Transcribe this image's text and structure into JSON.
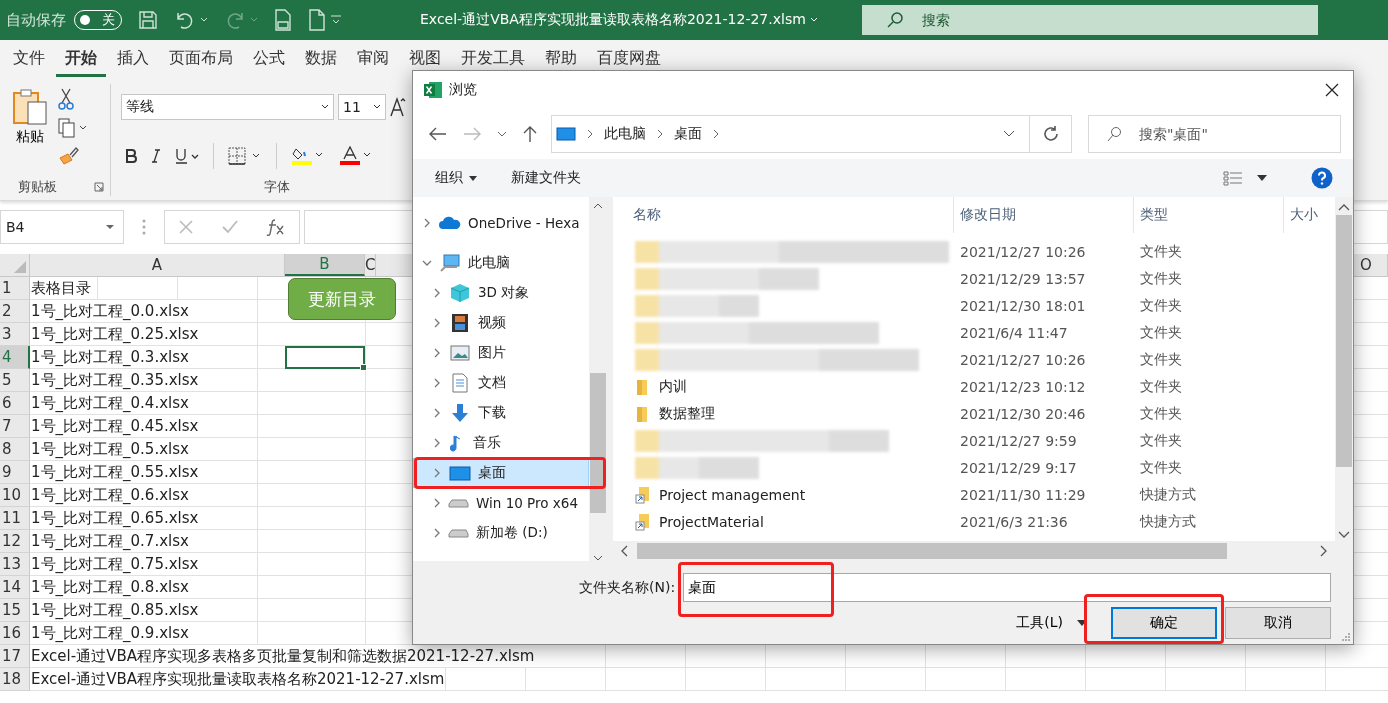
{
  "title_bar": {
    "autosave_label": "自动保存",
    "autosave": {
      "on": false,
      "label": "关"
    },
    "title": "Excel-通过VBA程序实现批量读取表格名称2021-12-27.xlsm",
    "search": {
      "placeholder": "搜索"
    }
  },
  "ribbon_tabs": [
    {
      "label": "文件",
      "selected": false
    },
    {
      "label": "开始",
      "selected": true
    },
    {
      "label": "插入",
      "selected": false
    },
    {
      "label": "页面布局",
      "selected": false
    },
    {
      "label": "公式",
      "selected": false
    },
    {
      "label": "数据",
      "selected": false
    },
    {
      "label": "审阅",
      "selected": false
    },
    {
      "label": "视图",
      "selected": false
    },
    {
      "label": "开发工具",
      "selected": false
    },
    {
      "label": "帮助",
      "selected": false
    },
    {
      "label": "百度网盘",
      "selected": false
    }
  ],
  "ribbon": {
    "paste_label": "粘贴",
    "clipboard_group": "剪贴板",
    "font_name": "等线",
    "font_size": "11",
    "font_group": "字体"
  },
  "formula_bar": {
    "name_box": "B4"
  },
  "sheet": {
    "button": "更新目录",
    "columns": [
      {
        "label": "A",
        "selected": false
      },
      {
        "label": "B",
        "selected": true
      },
      {
        "label": "C",
        "selected": false
      },
      {
        "label": "O",
        "selected": false
      }
    ],
    "rows": [
      {
        "number": "1",
        "a": "表格目录",
        "selected": false
      },
      {
        "number": "2",
        "a": "1号_比对工程_0.0.xlsx",
        "selected": false
      },
      {
        "number": "3",
        "a": "1号_比对工程_0.25.xlsx",
        "selected": false
      },
      {
        "number": "4",
        "a": "1号_比对工程_0.3.xlsx",
        "selected": true
      },
      {
        "number": "5",
        "a": "1号_比对工程_0.35.xlsx",
        "selected": false
      },
      {
        "number": "6",
        "a": "1号_比对工程_0.4.xlsx",
        "selected": false
      },
      {
        "number": "7",
        "a": "1号_比对工程_0.45.xlsx",
        "selected": false
      },
      {
        "number": "8",
        "a": "1号_比对工程_0.5.xlsx",
        "selected": false
      },
      {
        "number": "9",
        "a": "1号_比对工程_0.55.xlsx",
        "selected": false
      },
      {
        "number": "10",
        "a": "1号_比对工程_0.6.xlsx",
        "selected": false
      },
      {
        "number": "11",
        "a": "1号_比对工程_0.65.xlsx",
        "selected": false
      },
      {
        "number": "12",
        "a": "1号_比对工程_0.7.xlsx",
        "selected": false
      },
      {
        "number": "13",
        "a": "1号_比对工程_0.75.xlsx",
        "selected": false
      },
      {
        "number": "14",
        "a": "1号_比对工程_0.8.xlsx",
        "selected": false
      },
      {
        "number": "15",
        "a": "1号_比对工程_0.85.xlsx",
        "selected": false
      },
      {
        "number": "16",
        "a": "1号_比对工程_0.9.xlsx",
        "selected": false
      },
      {
        "number": "17",
        "a": "Excel-通过VBA程序实现多表格多页批量复制和筛选数据2021-12-27.xlsm",
        "selected": false
      },
      {
        "number": "18",
        "a": "Excel-通过VBA程序实现批量读取表格名称2021-12-27.xlsm",
        "selected": false
      }
    ]
  },
  "dialog": {
    "title": "浏览",
    "breadcrumb": [
      "此电脑",
      "桌面"
    ],
    "search_placeholder": "搜索\"桌面\"",
    "organize": "组织",
    "new_folder": "新建文件夹",
    "tree": [
      {
        "label": "OneDrive - Hexa",
        "kind": "cloud",
        "expanded": false,
        "selected": false
      },
      {
        "label": "此电脑",
        "kind": "pc",
        "expanded": true,
        "selected": false,
        "children": [
          {
            "label": "3D 对象",
            "kind": "cube",
            "expanded": false,
            "selected": false
          },
          {
            "label": "视频",
            "kind": "video",
            "expanded": false,
            "selected": false
          },
          {
            "label": "图片",
            "kind": "image",
            "expanded": false,
            "selected": false
          },
          {
            "label": "文档",
            "kind": "doc",
            "expanded": false,
            "selected": false
          },
          {
            "label": "下载",
            "kind": "download",
            "expanded": false,
            "selected": false
          },
          {
            "label": "音乐",
            "kind": "music",
            "expanded": false,
            "selected": false
          },
          {
            "label": "桌面",
            "kind": "desktop",
            "expanded": false,
            "selected": true
          },
          {
            "label": "Win 10 Pro x64",
            "kind": "drive",
            "expanded": false,
            "selected": false
          },
          {
            "label": "新加卷 (D:)",
            "kind": "drive",
            "expanded": false,
            "selected": false
          }
        ]
      }
    ],
    "columns": [
      "名称",
      "修改日期",
      "类型",
      "大小"
    ],
    "files": [
      {
        "kind": "blurred",
        "date": "2021/12/27 10:26",
        "type": "文件夹"
      },
      {
        "kind": "blurred",
        "date": "2021/12/29 13:57",
        "type": "文件夹"
      },
      {
        "kind": "blurred",
        "date": "2021/12/30 18:01",
        "type": "文件夹"
      },
      {
        "kind": "blurred",
        "date": "2021/6/4 11:47",
        "type": "文件夹"
      },
      {
        "kind": "blurred",
        "date": "2021/12/27 10:26",
        "type": "文件夹"
      },
      {
        "kind": "folder",
        "name": "内训",
        "date": "2021/12/23 10:12",
        "type": "文件夹"
      },
      {
        "kind": "folder",
        "name": "数据整理",
        "date": "2021/12/30 20:46",
        "type": "文件夹"
      },
      {
        "kind": "blurred",
        "date": "2021/12/27 9:59",
        "type": "文件夹"
      },
      {
        "kind": "blurred",
        "date": "2021/12/29 9:17",
        "type": "文件夹"
      },
      {
        "kind": "shortcut",
        "name": "Project management",
        "date": "2021/11/30 11:29",
        "type": "快捷方式"
      },
      {
        "kind": "shortcut",
        "name": "ProjectMaterial",
        "date": "2021/6/3 21:36",
        "type": "快捷方式"
      }
    ],
    "folder_label": "文件夹名称(N):",
    "folder_value": "桌面",
    "tools": "工具(L)",
    "ok": "确定",
    "cancel": "取消"
  }
}
